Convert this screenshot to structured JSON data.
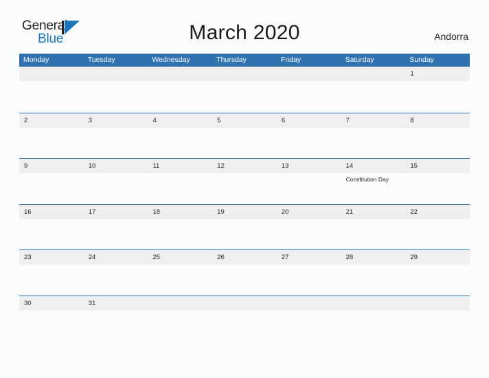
{
  "brand": {
    "name_part1": "General",
    "name_part2": "Blue",
    "logo_icon": "flag-triangle-icon",
    "color_dark": "#231f20",
    "color_blue": "#1d76bc"
  },
  "header": {
    "title": "March 2020",
    "locale": "Andorra"
  },
  "theme": {
    "header_blue": "#3071b0",
    "row_divider_blue": "#2e75b6",
    "band_gray": "#efefef",
    "page_background": "#fbfcfd",
    "text_dark": "#232323"
  },
  "calendar": {
    "month": "March",
    "year": "2020",
    "weekday_headers": [
      "Monday",
      "Tuesday",
      "Wednesday",
      "Thursday",
      "Friday",
      "Saturday",
      "Sunday"
    ],
    "weeks": [
      {
        "days": [
          {
            "number": "",
            "events": []
          },
          {
            "number": "",
            "events": []
          },
          {
            "number": "",
            "events": []
          },
          {
            "number": "",
            "events": []
          },
          {
            "number": "",
            "events": []
          },
          {
            "number": "",
            "events": []
          },
          {
            "number": "1",
            "events": []
          }
        ]
      },
      {
        "days": [
          {
            "number": "2",
            "events": []
          },
          {
            "number": "3",
            "events": []
          },
          {
            "number": "4",
            "events": []
          },
          {
            "number": "5",
            "events": []
          },
          {
            "number": "6",
            "events": []
          },
          {
            "number": "7",
            "events": []
          },
          {
            "number": "8",
            "events": []
          }
        ]
      },
      {
        "days": [
          {
            "number": "9",
            "events": []
          },
          {
            "number": "10",
            "events": []
          },
          {
            "number": "11",
            "events": []
          },
          {
            "number": "12",
            "events": []
          },
          {
            "number": "13",
            "events": []
          },
          {
            "number": "14",
            "events": [
              "Constitution Day"
            ]
          },
          {
            "number": "15",
            "events": []
          }
        ]
      },
      {
        "days": [
          {
            "number": "16",
            "events": []
          },
          {
            "number": "17",
            "events": []
          },
          {
            "number": "18",
            "events": []
          },
          {
            "number": "19",
            "events": []
          },
          {
            "number": "20",
            "events": []
          },
          {
            "number": "21",
            "events": []
          },
          {
            "number": "22",
            "events": []
          }
        ]
      },
      {
        "days": [
          {
            "number": "23",
            "events": []
          },
          {
            "number": "24",
            "events": []
          },
          {
            "number": "25",
            "events": []
          },
          {
            "number": "26",
            "events": []
          },
          {
            "number": "27",
            "events": []
          },
          {
            "number": "28",
            "events": []
          },
          {
            "number": "29",
            "events": []
          }
        ]
      },
      {
        "days": [
          {
            "number": "30",
            "events": []
          },
          {
            "number": "31",
            "events": []
          },
          {
            "number": "",
            "events": []
          },
          {
            "number": "",
            "events": []
          },
          {
            "number": "",
            "events": []
          },
          {
            "number": "",
            "events": []
          },
          {
            "number": "",
            "events": []
          }
        ]
      }
    ]
  }
}
